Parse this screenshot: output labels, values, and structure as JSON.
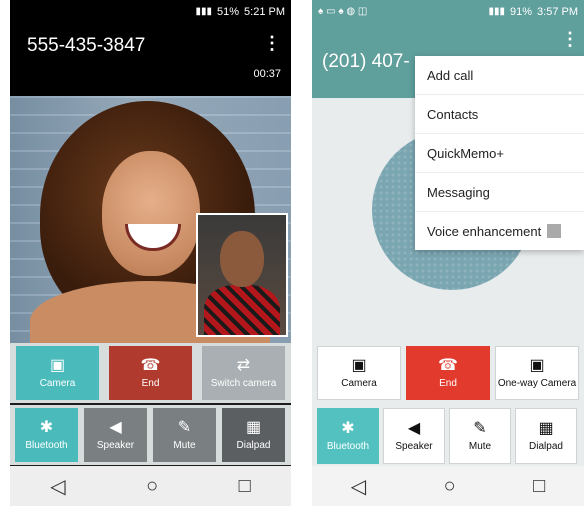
{
  "left": {
    "status": {
      "battery": "51%",
      "time": "5:21 PM"
    },
    "header": {
      "number": "555-435-3847",
      "menu_icon": "⋮",
      "timer": "00:37"
    },
    "row1": [
      {
        "label": "Camera",
        "icon": "▣"
      },
      {
        "label": "End",
        "icon": "☎"
      },
      {
        "label": "Switch camera",
        "icon": "⇄"
      }
    ],
    "row2": [
      {
        "label": "Bluetooth",
        "icon": "✱"
      },
      {
        "label": "Speaker",
        "icon": "◀"
      },
      {
        "label": "Mute",
        "icon": "✎"
      },
      {
        "label": "Dialpad",
        "icon": "▦"
      }
    ],
    "nav": {
      "back": "◁",
      "home": "○",
      "recent": "□"
    }
  },
  "right": {
    "status": {
      "left_icons": "♠ ▭ ♠ ◍ ◫",
      "battery": "91%",
      "time": "3:57 PM"
    },
    "header": {
      "number": "(201) 407-",
      "menu_icon": "⋮"
    },
    "dropdown": [
      "Add call",
      "Contacts",
      "QuickMemo+",
      "Messaging",
      "Voice enhancement"
    ],
    "row1": [
      {
        "label": "Camera",
        "icon": "▣"
      },
      {
        "label": "End",
        "icon": "☎"
      },
      {
        "label": "One-way Camera",
        "icon": "▣"
      }
    ],
    "row2": [
      {
        "label": "Bluetooth",
        "icon": "✱"
      },
      {
        "label": "Speaker",
        "icon": "◀"
      },
      {
        "label": "Mute",
        "icon": "✎"
      },
      {
        "label": "Dialpad",
        "icon": "▦"
      }
    ],
    "nav": {
      "back": "◁",
      "home": "○",
      "recent": "□"
    }
  }
}
